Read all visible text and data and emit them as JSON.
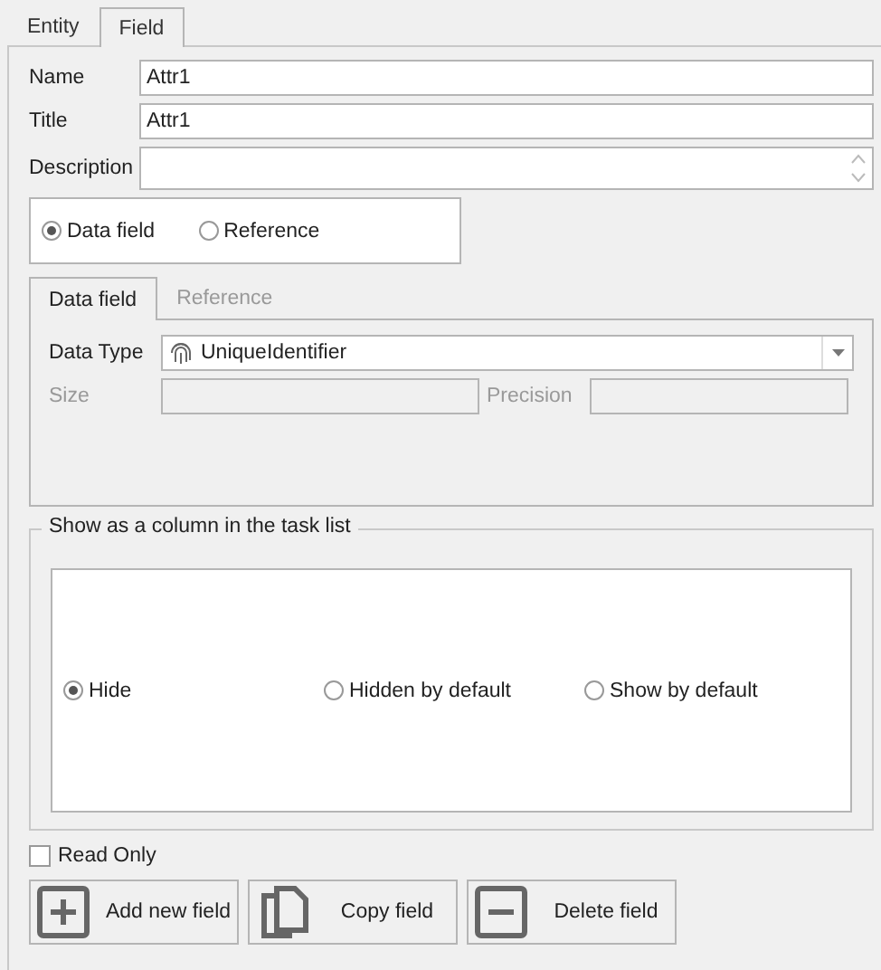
{
  "tabs": [
    {
      "label": "Entity",
      "selected": false
    },
    {
      "label": "Field",
      "selected": true
    }
  ],
  "fields": [
    {
      "label": "Name",
      "value": "Attr1",
      "kind": "text"
    },
    {
      "label": "Title",
      "value": "Attr1",
      "kind": "text"
    },
    {
      "label": "Description",
      "kind": "memo"
    }
  ],
  "field_type": [
    {
      "label": "Data field",
      "selected": true
    },
    {
      "label": "Reference",
      "selected": false
    }
  ],
  "inner_tabs": [
    {
      "label": "Data field",
      "selected": true
    },
    {
      "label": "Reference",
      "selected": false
    }
  ],
  "data_type": {
    "label": "Data Type",
    "value": "UniqueIdentifier"
  },
  "size": {
    "label": "Size",
    "disabled": true
  },
  "precision": {
    "label": "Precision",
    "disabled": true
  },
  "column_group": {
    "title": "Show as a column in the task list",
    "options": [
      {
        "label": "Hide",
        "selected": true
      },
      {
        "label": "Hidden by default",
        "selected": false
      },
      {
        "label": "Show by default",
        "selected": false
      }
    ]
  },
  "read_only": {
    "label": "Read Only",
    "checked": false
  },
  "buttons": [
    {
      "label": "Add new field",
      "kind": "add"
    },
    {
      "label": "Copy field",
      "kind": "copy"
    },
    {
      "label": "Delete field",
      "kind": "delete"
    }
  ]
}
